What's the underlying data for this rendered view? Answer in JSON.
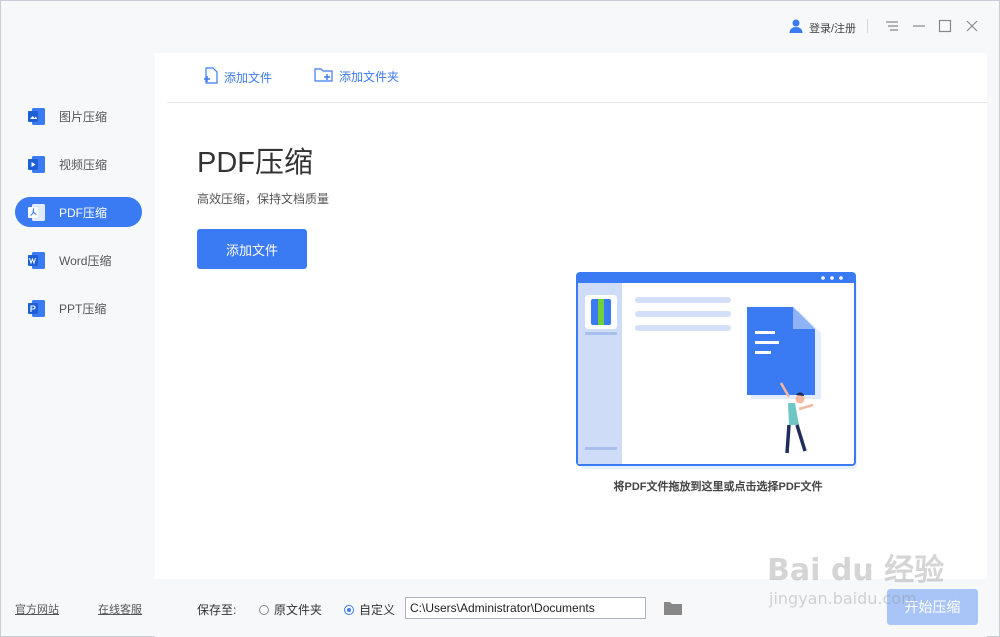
{
  "titlebar": {
    "user_label": "登录/注册",
    "icons": [
      "user-icon",
      "menu-icon",
      "minimize-icon",
      "maximize-icon",
      "close-icon"
    ]
  },
  "sidebar": {
    "items": [
      {
        "label": "图片压缩",
        "icon": "image-file-icon",
        "active": false
      },
      {
        "label": "视频压缩",
        "icon": "video-file-icon",
        "active": false
      },
      {
        "label": "PDF压缩",
        "icon": "pdf-file-icon",
        "active": true
      },
      {
        "label": "Word压缩",
        "icon": "word-file-icon",
        "active": false
      },
      {
        "label": "PPT压缩",
        "icon": "ppt-file-icon",
        "active": false
      }
    ],
    "footer_links": {
      "website": "官方网站",
      "support": "在线客服"
    }
  },
  "toolbar": {
    "add_file": "添加文件",
    "add_folder": "添加文件夹"
  },
  "main": {
    "title": "PDF压缩",
    "subtitle": "高效压缩，保持文档质量",
    "add_button": "添加文件",
    "drop_hint": "将PDF文件拖放到这里或点击选择PDF文件"
  },
  "bottombar": {
    "save_label": "保存至:",
    "option_original": "原文件夹",
    "option_custom": "自定义",
    "selected_option": "自定义",
    "path_value": "C:\\Users\\Administrator\\Documents",
    "start_button": "开始压缩"
  },
  "watermark": {
    "line1": "Bai du 经验",
    "line2": "jingyan.baidu.com"
  },
  "colors": {
    "accent": "#3a7af2",
    "accent_disabled": "#a9c5f7",
    "background": "#f7f8fa"
  }
}
